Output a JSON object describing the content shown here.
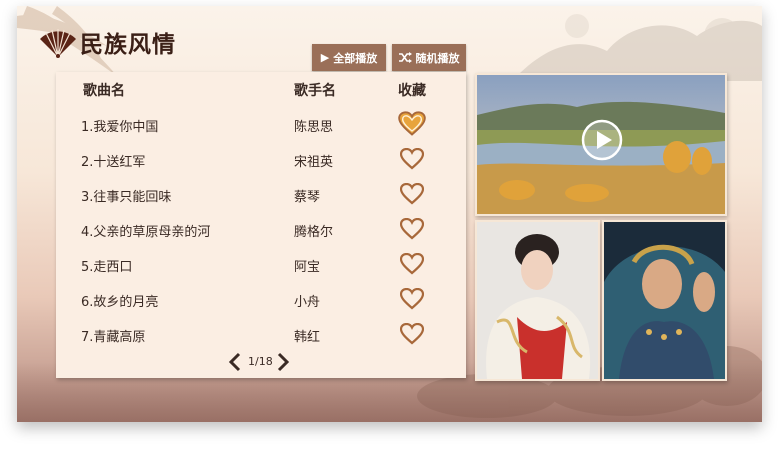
{
  "app": {
    "title": "民族风情"
  },
  "toolbar": {
    "play_all_label": "全部播放",
    "shuffle_label": "随机播放",
    "play_icon": "play-triangle-icon",
    "shuffle_icon": "shuffle-icon"
  },
  "table": {
    "headers": {
      "song": "歌曲名",
      "singer": "歌手名",
      "favorite": "收藏"
    },
    "rows": [
      {
        "song": "1.我爱你中国",
        "singer": "陈思思",
        "favorited": true
      },
      {
        "song": "2.十送红军",
        "singer": "宋祖英",
        "favorited": false
      },
      {
        "song": "3.往事只能回味",
        "singer": "蔡琴",
        "favorited": false
      },
      {
        "song": "4.父亲的草原母亲的河",
        "singer": "腾格尔",
        "favorited": false
      },
      {
        "song": "5.走西口",
        "singer": "阿宝",
        "favorited": false
      },
      {
        "song": "6.故乡的月亮",
        "singer": "小舟",
        "favorited": false
      },
      {
        "song": "7.青藏高原",
        "singer": "韩红",
        "favorited": false
      }
    ]
  },
  "pagination": {
    "text": "1/18",
    "current": 1,
    "total": 18
  },
  "colors": {
    "button_bg": "#9a6f58",
    "heart_outline": "#a8683a",
    "heart_selected_fill": "#e8a43c",
    "panel_bg": "#fbeee3",
    "title_text": "#3a1f16"
  },
  "media": {
    "video_icon": "play-circle-icon",
    "heart_icon": "heart-icon"
  }
}
